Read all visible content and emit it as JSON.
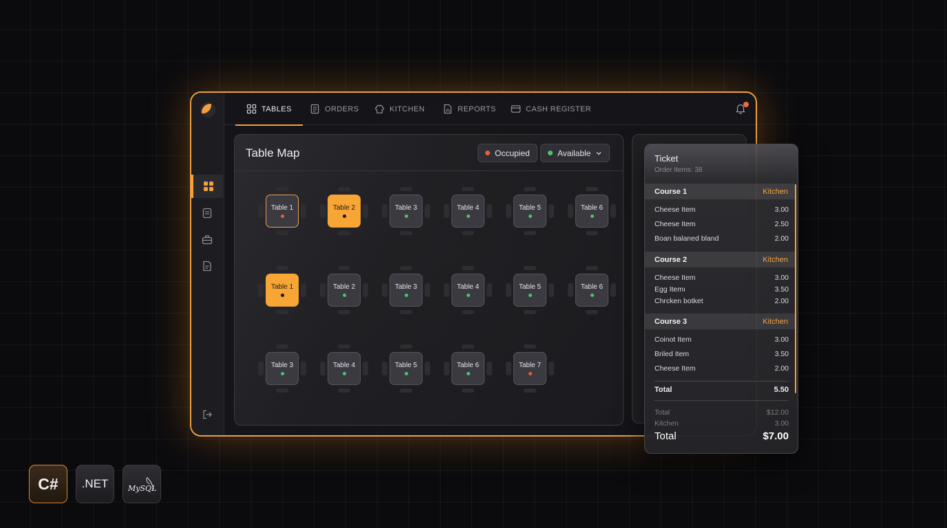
{
  "nav": {
    "tabs": [
      {
        "label": "TABLES",
        "icon": "table-grid-icon"
      },
      {
        "label": "ORDERS",
        "icon": "document-icon"
      },
      {
        "label": "KITCHEN",
        "icon": "chef-hat-icon"
      },
      {
        "label": "REPORTS",
        "icon": "report-chart-icon"
      },
      {
        "label": "CASH REGISTER",
        "icon": "credit-card-icon"
      }
    ],
    "active_tab": "TABLES"
  },
  "sidebar": {
    "items": [
      "dashboard-grid-icon",
      "list-document-icon",
      "briefcase-icon",
      "report-icon"
    ],
    "bottom": "logout-icon"
  },
  "table_map": {
    "title": "Table Map",
    "filter_occupied": "Occupied",
    "filter_available": "Available",
    "rows": [
      [
        {
          "label": "Table 1",
          "status": "occupied",
          "style": "outline"
        },
        {
          "label": "Table 2",
          "status": "selected",
          "style": "filled"
        },
        {
          "label": "Table 3",
          "status": "available",
          "style": "normal"
        },
        {
          "label": "Table 4",
          "status": "available",
          "style": "normal"
        },
        {
          "label": "Table 5",
          "status": "available",
          "style": "normal"
        },
        {
          "label": "Table 6",
          "status": "available",
          "style": "normal"
        }
      ],
      [
        {
          "label": "Table 1",
          "status": "selected",
          "style": "filled"
        },
        {
          "label": "Table 2",
          "status": "available",
          "style": "normal"
        },
        {
          "label": "Table 3",
          "status": "available",
          "style": "normal"
        },
        {
          "label": "Table 4",
          "status": "available",
          "style": "normal"
        },
        {
          "label": "Table 5",
          "status": "available",
          "style": "normal"
        },
        {
          "label": "Table 6",
          "status": "available",
          "style": "normal"
        }
      ],
      [
        {
          "label": "Table 3",
          "status": "available",
          "style": "normal"
        },
        {
          "label": "Table 4",
          "status": "available",
          "style": "normal"
        },
        {
          "label": "Table 5",
          "status": "available",
          "style": "normal"
        },
        {
          "label": "Table 6",
          "status": "available",
          "style": "normal"
        },
        {
          "label": "Table 7",
          "status": "occupied",
          "style": "normal"
        }
      ]
    ]
  },
  "ticket": {
    "title": "Ticket",
    "subtitle": "Order Items: 38",
    "courses": [
      {
        "name": "Course 1",
        "destination": "Kitchen",
        "items": [
          {
            "name": "Cheese Item",
            "price": "3.00"
          },
          {
            "name": "Cheese Item",
            "price": "2.50"
          },
          {
            "name": "Boan balaned bland",
            "price": "2.00"
          }
        ]
      },
      {
        "name": "Course 2",
        "destination": "Kitchen",
        "items": [
          {
            "name": "Cheese Item",
            "price": "3.00"
          },
          {
            "name": "Egg Itemı",
            "price": "3.50"
          },
          {
            "name": "Chrcken botket",
            "price": "2.00"
          }
        ]
      },
      {
        "name": "Course 3",
        "destination": "Kitchen",
        "items": [
          {
            "name": "Coinot Item",
            "price": "3.00"
          },
          {
            "name": "Briled Item",
            "price": "3.50"
          },
          {
            "name": "Cheese Item",
            "price": "2.00"
          }
        ]
      }
    ],
    "subtotal_label": "Total",
    "subtotal_value": "5.50",
    "summary": [
      {
        "label": "Total",
        "value": "$12.00"
      },
      {
        "label": "Kitchen",
        "value": "3.00"
      }
    ],
    "grand_total_label": "Total",
    "grand_total_value": "$7.00"
  },
  "badges": {
    "csharp": "C#",
    "dotnet": ".NET",
    "mysql": "MySQL"
  },
  "colors": {
    "accent": "#f5a03c",
    "occupied": "#e8603c",
    "available": "#4cc46a",
    "background": "#0b0b0e"
  }
}
